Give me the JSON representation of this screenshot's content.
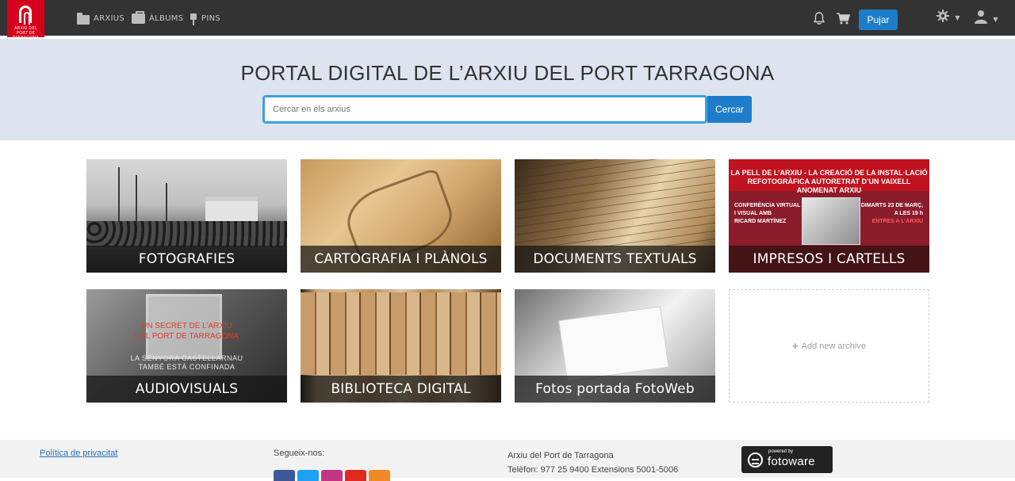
{
  "header": {
    "logo": {
      "line1": "ARXIU DEL",
      "line2": "PORT DE TARRAGONA"
    },
    "nav": [
      {
        "label": "ARXIUS",
        "icon": "folder-icon"
      },
      {
        "label": "ÀLBUMS",
        "icon": "briefcase-icon"
      },
      {
        "label": "PINS",
        "icon": "pin-icon"
      }
    ],
    "upload_label": "Pujar",
    "icons": [
      "bell-icon",
      "cart-icon",
      "gear-icon",
      "user-icon"
    ]
  },
  "hero": {
    "title": "PORTAL DIGITAL DE L’ARXIU DEL PORT TARRAGONA",
    "search_placeholder": "Cercar en els arxius",
    "search_button": "Cercar"
  },
  "archives": [
    {
      "label": "FOTOGRAFIES"
    },
    {
      "label": "CARTOGRAFIA I PLÀNOLS"
    },
    {
      "label": "DOCUMENTS TEXTUALS"
    },
    {
      "label": "IMPRESOS I CARTELLS",
      "poster": {
        "head1": "LA PELL DE L’ARXIU - LA CREACIÓ DE LA INSTAL·LACIÓ",
        "head2": "REFOTOGRÀFICA AUTORETRAT D’UN VAIXELL ANOMENAT ARXIU",
        "left1": "CONFERÈNCIA VIRTUAL",
        "left2": "I VISUAL AMB",
        "left3": "RICARD MARTÍNEZ",
        "right1": "DIMARTS 23 DE MARÇ,",
        "right2": "A LES 19 h",
        "right3": "ENTRES A L’ARXIU"
      }
    },
    {
      "label": "AUDIOVISUALS",
      "overlay": {
        "red1": "UN SECRET DE L’ARXIU",
        "red2": "DEL PORT DE TARRAGONA",
        "white1": "LA SENYORA CASTELLARNAU",
        "white2": "TAMBÉ ESTÀ CONFINADA"
      }
    },
    {
      "label": "BIBLIOTECA DIGITAL"
    },
    {
      "label": "Fotos portada FotoWeb"
    }
  ],
  "add_archive_label": "Add new archive",
  "footer": {
    "privacy": "Política de privacitat",
    "follow": "Segueix-nos:",
    "social": [
      "facebook-icon",
      "twitter-icon",
      "instagram-icon",
      "youtube-icon",
      "rss-icon"
    ],
    "org_name": "Arxiu del Port de Tarragona",
    "phone": "Telèfon: 977 25 9400 Extensions 5001-5006",
    "badge_small": "powered by",
    "badge_big": "fotoware"
  },
  "colors": {
    "navbar": "#333333",
    "accent": "#1e7dc9",
    "hero_bg": "#dde4ef",
    "brand_red": "#d6001c"
  }
}
